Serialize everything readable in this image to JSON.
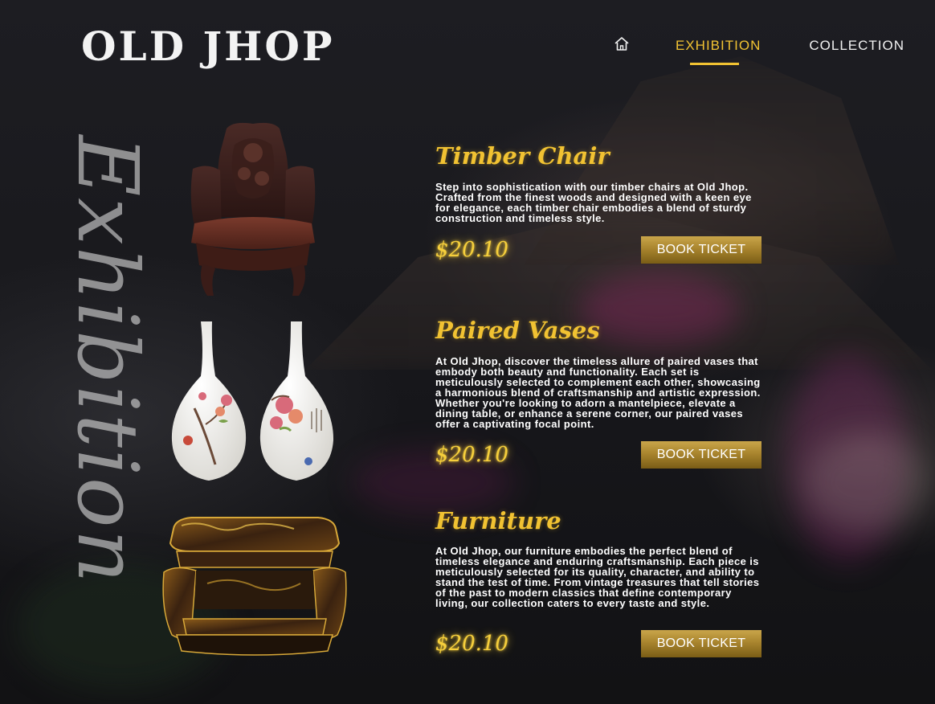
{
  "brand": {
    "logo_text": "OLD JHOP"
  },
  "nav": {
    "home_icon": "home-icon",
    "items": [
      {
        "label": "EXHIBITION",
        "active": true
      },
      {
        "label": "COLLECTION",
        "active": false
      }
    ]
  },
  "side_title": "Exhibition",
  "colors": {
    "accent_gold": "#f1c232",
    "button_gold": "#a9852e",
    "background": "#141416"
  },
  "products": [
    {
      "title": "Timber Chair",
      "description": "Step into sophistication with our timber chairs at Old Jhop. Crafted from the finest woods and designed with a keen eye for elegance, each timber chair embodies a blend of sturdy construction and timeless style.",
      "price": "$20.10",
      "button_label": "BOOK TICKET",
      "image_icon": "carved-chair-image"
    },
    {
      "title": "Paired Vases",
      "description": "At Old Jhop, discover the timeless allure of paired vases that embody both beauty and functionality. Each set is meticulously selected to complement each other, showcasing a harmonious blend of craftsmanship and artistic expression. Whether you're looking to adorn a mantelpiece, elevate a dining table, or enhance a serene corner, our paired vases offer a captivating focal point.",
      "price": "$20.10",
      "button_label": "BOOK TICKET",
      "image_icon": "paired-vases-image"
    },
    {
      "title": "Furniture",
      "description": "At Old Jhop, our furniture embodies the perfect blend of timeless elegance and enduring craftsmanship. Each piece is meticulously selected for its quality, character, and ability to stand the test of time. From vintage treasures that tell stories of the past to modern classics that define contemporary living, our collection caters to every taste and style.",
      "price": "$20.10",
      "button_label": "BOOK TICKET",
      "image_icon": "lacquer-table-image"
    }
  ]
}
